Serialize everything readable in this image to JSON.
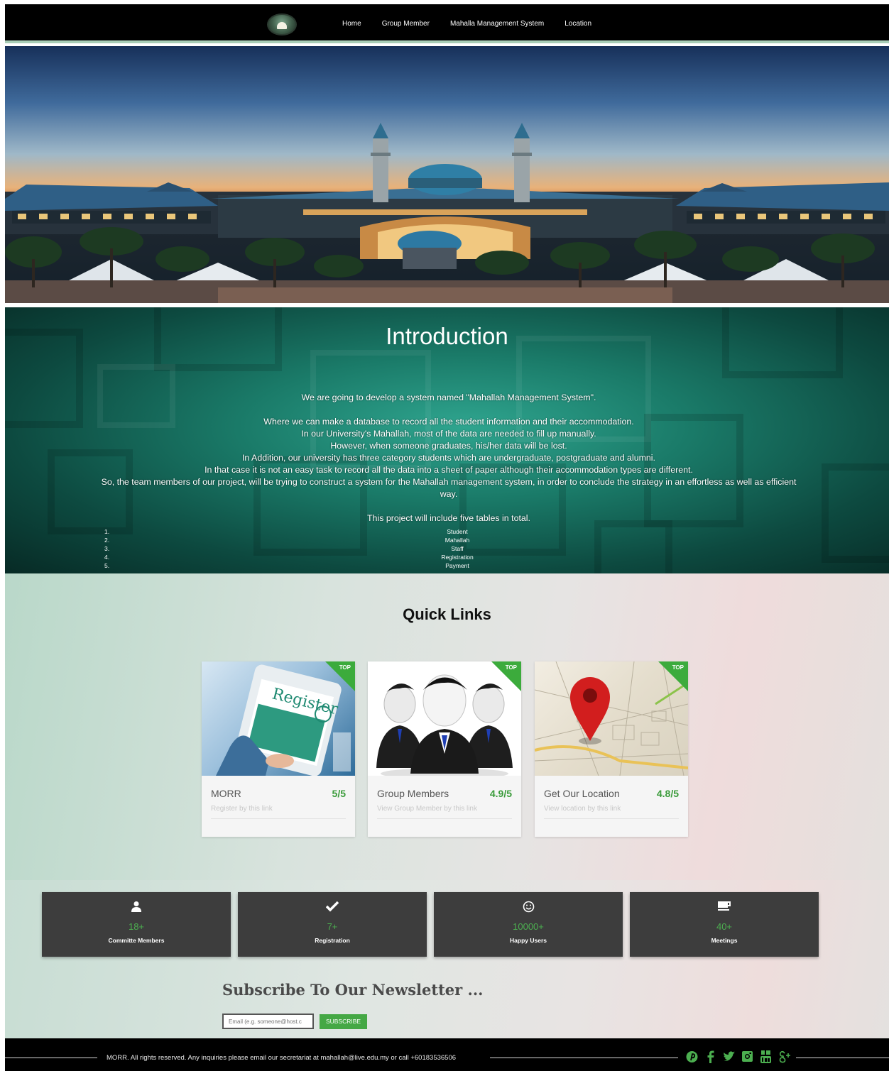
{
  "nav": {
    "logo": "mahallah-logo-icon",
    "links": [
      "Home",
      "Group Member",
      "Mahalla Management System",
      "Location"
    ]
  },
  "hero": {
    "image": "mosque-at-sunset"
  },
  "intro": {
    "title": "Introduction",
    "paragraphs": [
      "We are going to develop a system named \"Mahallah Management System\".",
      "",
      "Where we can make a database to record all the student information and their accommodation.",
      "In our University's Mahallah, most of the data are needed to fill up manually.",
      "However, when someone graduates, his/her data will be lost.",
      "In Addition, our university has three category students which are undergraduate, postgraduate and alumni.",
      "In that case it is not an easy task to record all the data into a sheet of paper although their accommodation types are different.",
      "So, the team members of our project, will be trying to construct a system for the Mahallah management system, in order to conclude the strategy in an effortless as well as efficient way.",
      "",
      "This project will include five tables in total."
    ],
    "tables": [
      {
        "num": "1.",
        "name": "Student"
      },
      {
        "num": "2.",
        "name": "Mahallah"
      },
      {
        "num": "3.",
        "name": "Staff"
      },
      {
        "num": "4.",
        "name": "Registration"
      },
      {
        "num": "5.",
        "name": "Payment"
      }
    ]
  },
  "quick_links": {
    "title": "Quick Links",
    "cards": [
      {
        "badge": "TOP",
        "title": "MORR",
        "rating": "5/5",
        "subtitle": "Register by this link",
        "image": "register-tablet-image"
      },
      {
        "badge": "TOP",
        "title": "Group Members",
        "rating": "4.9/5",
        "subtitle": "View Group Member by this link",
        "image": "group-people-image"
      },
      {
        "badge": "TOP",
        "title": "Get Our Location",
        "rating": "4.8/5",
        "subtitle": "View location by this link",
        "image": "map-pin-image"
      }
    ]
  },
  "stats": [
    {
      "icon": "user-icon",
      "value": "18+",
      "label": "Committe Members"
    },
    {
      "icon": "check-icon",
      "value": "7+",
      "label": "Registration"
    },
    {
      "icon": "smile-icon",
      "value": "10000+",
      "label": "Happy Users"
    },
    {
      "icon": "coffee-cup-icon",
      "value": "40+",
      "label": "Meetings"
    }
  ],
  "newsletter": {
    "title": "Subscribe To Our Newsletter ...",
    "placeholder": "Email (e.g. someone@host.c",
    "button": "SUBSCRIBE"
  },
  "footer": {
    "text": "MORR. All rights reserved. Any inquiries please email our secretariat at mahallah@live.edu.my or call +60183536506",
    "social": [
      "pinterest-icon",
      "facebook-icon",
      "twitter-icon",
      "instagram-icon",
      "youtube-icon",
      "google-plus-icon"
    ]
  },
  "colors": {
    "accent": "#4caf50",
    "nav": "#000000",
    "stat_bg": "#3d3d3d",
    "ribbon": "#3cab3c"
  }
}
